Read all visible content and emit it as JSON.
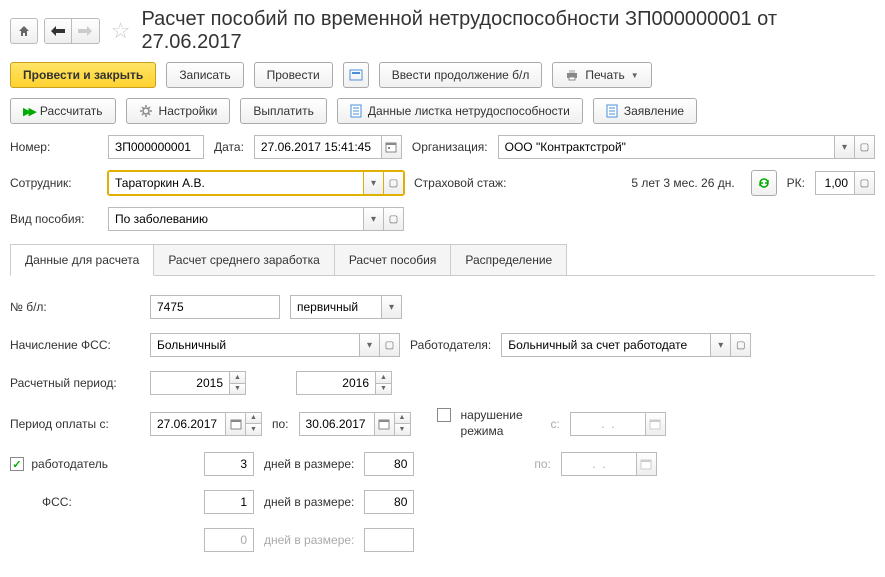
{
  "title": "Расчет пособий по временной нетрудоспособности ЗП000000001 от 27.06.2017",
  "toolbar1": {
    "postAndClose": "Провести и закрыть",
    "save": "Записать",
    "post": "Провести",
    "enterContinuation": "Ввести продолжение б/л",
    "print": "Печать"
  },
  "toolbar2": {
    "calculate": "Рассчитать",
    "settings": "Настройки",
    "pay": "Выплатить",
    "sickLeaveData": "Данные листка нетрудоспособности",
    "application": "Заявление"
  },
  "labels": {
    "number": "Номер:",
    "date": "Дата:",
    "organization": "Организация:",
    "employee": "Сотрудник:",
    "insurancePeriod": "Страховой стаж:",
    "rk": "РК:",
    "benefitType": "Вид пособия:",
    "sickLeaveNumber": "№ б/л:",
    "fssAccrual": "Начисление ФСС:",
    "employer": "Работодателя:",
    "calcPeriod": "Расчетный период:",
    "paymentPeriodFrom": "Период оплаты с:",
    "to": "по:",
    "violation": "нарушение режима",
    "from": "с:",
    "employerCheck": "работодатель",
    "fss": "ФСС:",
    "daysAtRate": "дней в размере:"
  },
  "values": {
    "number": "ЗП000000001",
    "date": "27.06.2017 15:41:45",
    "organization": "ООО \"Контрактстрой\"",
    "employee": "Тараторкин А.В.",
    "insurancePeriod": "5 лет 3 мес. 26 дн.",
    "rk": "1,00",
    "benefitType": "По заболеванию",
    "sickLeaveNumber": "7475",
    "sickLeaveType": "первичный",
    "fssAccrual": "Больничный",
    "employerAccrual": "Больничный за счет работодате",
    "calcYearFrom": "2015",
    "calcYearTo": "2016",
    "paymentFrom": "27.06.2017",
    "paymentTo": "30.06.2017",
    "employerDays": "3",
    "employerRate": "80",
    "fssDays": "1",
    "fssRate": "80",
    "zeroDays": "0",
    "violationFrom": ".  .",
    "violationTo": ".  ."
  },
  "tabs": {
    "calcData": "Данные для расчета",
    "avgEarnings": "Расчет среднего заработка",
    "benefitCalc": "Расчет пособия",
    "distribution": "Распределение"
  }
}
